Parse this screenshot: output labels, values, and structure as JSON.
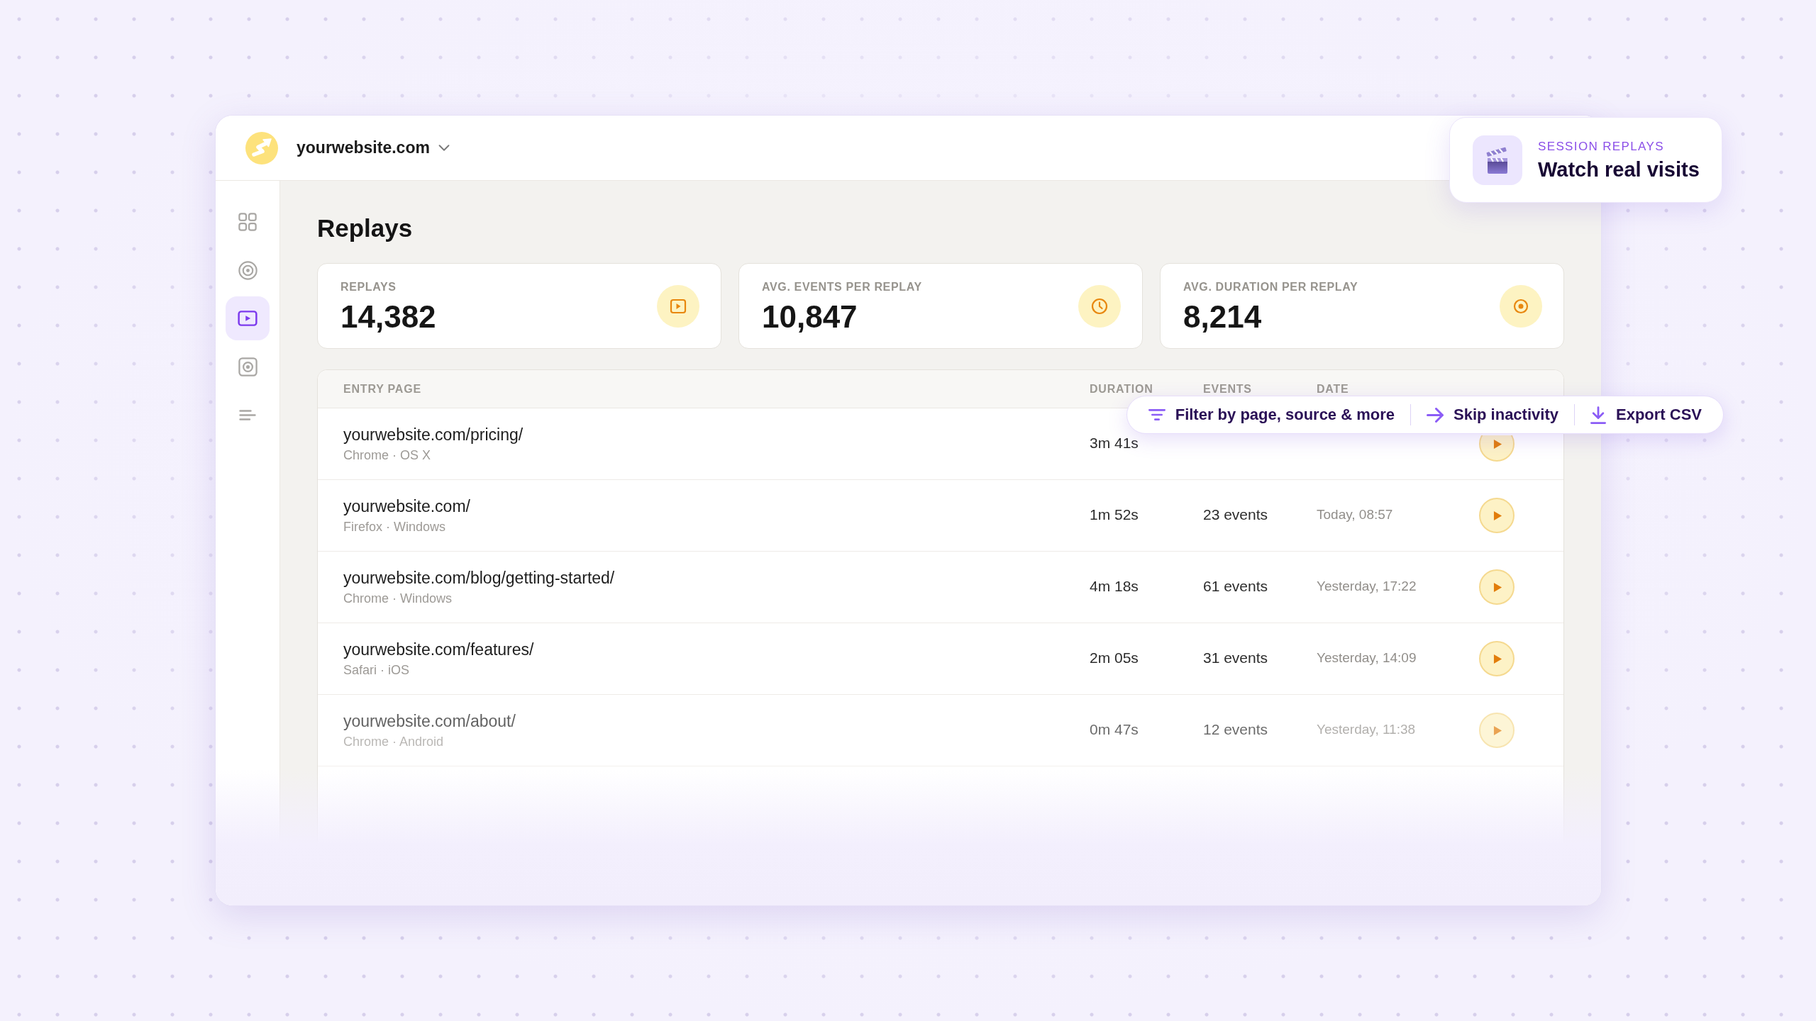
{
  "header": {
    "site": "yourwebsite.com"
  },
  "sidebar": {
    "items": [
      {
        "selected": false
      },
      {
        "selected": false
      },
      {
        "selected": true
      },
      {
        "selected": false
      },
      {
        "selected": false
      }
    ]
  },
  "page_title": "Replays",
  "stats": [
    {
      "label": "REPLAYS",
      "value": "14,382"
    },
    {
      "label": "AVG. EVENTS PER REPLAY",
      "value": "10,847"
    },
    {
      "label": "AVG. DURATION PER REPLAY",
      "value": "8,214"
    }
  ],
  "table": {
    "columns": [
      "ENTRY PAGE",
      "DURATION",
      "EVENTS",
      "DATE"
    ],
    "rows": [
      {
        "page": "yourwebsite.com/pricing/",
        "meta": "Chrome · OS X",
        "duration": "3m 41s"
      },
      {
        "page": "yourwebsite.com/",
        "meta": "Firefox · Windows",
        "duration": "1m 52s",
        "events": "23 events",
        "date": "Today, 08:57"
      },
      {
        "page": "yourwebsite.com/blog/getting-started/",
        "meta": "Chrome · Windows",
        "duration": "4m 18s",
        "events": "61 events",
        "date": "Yesterday, 17:22"
      },
      {
        "page": "yourwebsite.com/features/",
        "meta": "Safari · iOS",
        "duration": "2m 05s",
        "events": "31 events",
        "date": "Yesterday, 14:09"
      },
      {
        "page": "yourwebsite.com/about/",
        "meta": "Chrome · Android",
        "duration": "0m 47s",
        "events": "12 events",
        "date": "Yesterday, 11:38"
      }
    ]
  },
  "toolbar": {
    "actions": [
      {
        "label": "Filter by page, source & more"
      },
      {
        "label": "Skip inactivity"
      },
      {
        "label": "Export CSV"
      }
    ]
  },
  "badge": {
    "eyebrow": "SESSION REPLAYS",
    "title": "Watch real visits"
  }
}
